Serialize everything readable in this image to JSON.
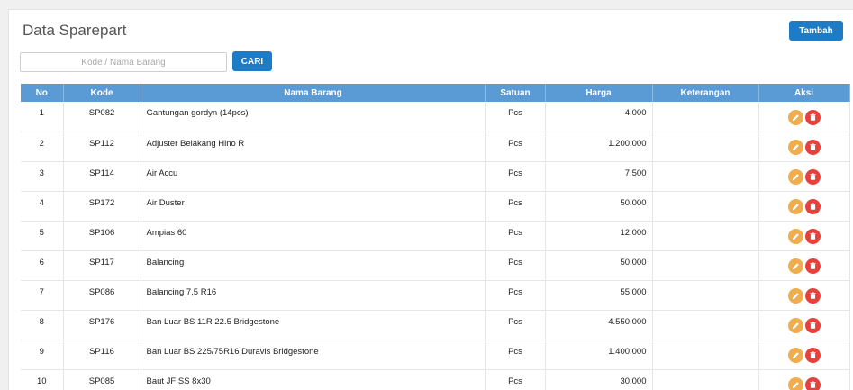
{
  "header": {
    "title": "Data Sparepart",
    "add_label": "Tambah"
  },
  "search": {
    "placeholder": "Kode / Nama Barang",
    "value": "",
    "button_label": "CARI"
  },
  "table": {
    "columns": [
      "No",
      "Kode",
      "Nama Barang",
      "Satuan",
      "Harga",
      "Keterangan",
      "Aksi"
    ],
    "rows": [
      {
        "no": "1",
        "kode": "SP082",
        "nama": "Gantungan gordyn (14pcs)",
        "satuan": "Pcs",
        "harga": "4.000",
        "keterangan": ""
      },
      {
        "no": "2",
        "kode": "SP112",
        "nama": "Adjuster Belakang Hino R",
        "satuan": "Pcs",
        "harga": "1.200.000",
        "keterangan": ""
      },
      {
        "no": "3",
        "kode": "SP114",
        "nama": "Air Accu",
        "satuan": "Pcs",
        "harga": "7.500",
        "keterangan": ""
      },
      {
        "no": "4",
        "kode": "SP172",
        "nama": "Air Duster",
        "satuan": "Pcs",
        "harga": "50.000",
        "keterangan": ""
      },
      {
        "no": "5",
        "kode": "SP106",
        "nama": "Ampias 60",
        "satuan": "Pcs",
        "harga": "12.000",
        "keterangan": ""
      },
      {
        "no": "6",
        "kode": "SP117",
        "nama": "Balancing",
        "satuan": "Pcs",
        "harga": "50.000",
        "keterangan": ""
      },
      {
        "no": "7",
        "kode": "SP086",
        "nama": "Balancing 7,5 R16",
        "satuan": "Pcs",
        "harga": "55.000",
        "keterangan": ""
      },
      {
        "no": "8",
        "kode": "SP176",
        "nama": "Ban Luar BS 11R 22.5 Bridgestone",
        "satuan": "Pcs",
        "harga": "4.550.000",
        "keterangan": ""
      },
      {
        "no": "9",
        "kode": "SP116",
        "nama": "Ban Luar BS 225/75R16 Duravis Bridgestone",
        "satuan": "Pcs",
        "harga": "1.400.000",
        "keterangan": ""
      },
      {
        "no": "10",
        "kode": "SP085",
        "nama": "Baut JF SS 8x30",
        "satuan": "Pcs",
        "harga": "30.000",
        "keterangan": ""
      }
    ],
    "actions": {
      "edit_icon": "pencil-icon",
      "delete_icon": "trash-icon"
    }
  },
  "colors": {
    "header_bg": "#5b9bd5",
    "primary_button": "#1e7bc6",
    "edit": "#f0ad4e",
    "delete": "#e8403a"
  }
}
